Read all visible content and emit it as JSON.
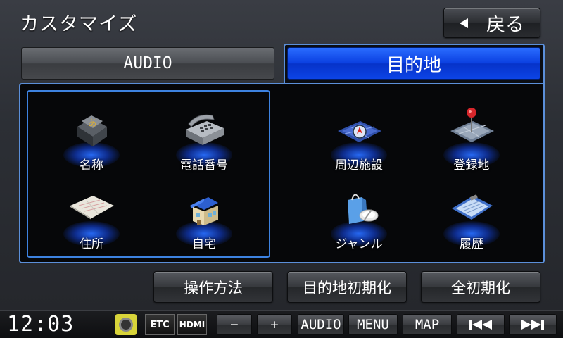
{
  "header": {
    "title": "カスタマイズ",
    "back_label": "戻る"
  },
  "tabs": [
    {
      "label": "AUDIO"
    },
    {
      "label": "目的地"
    }
  ],
  "items": [
    {
      "label": "名称",
      "icon": "name-search-icon"
    },
    {
      "label": "電話番号",
      "icon": "telephone-icon"
    },
    {
      "label": "周辺施設",
      "icon": "nearby-facility-icon"
    },
    {
      "label": "登録地",
      "icon": "registered-location-pin-icon"
    },
    {
      "label": "住所",
      "icon": "address-map-icon"
    },
    {
      "label": "自宅",
      "icon": "home-house-icon"
    },
    {
      "label": "ジャンル",
      "icon": "genre-shopping-icon"
    },
    {
      "label": "履歴",
      "icon": "history-clipboard-icon"
    }
  ],
  "bottom_buttons": {
    "howto": "操作方法",
    "dest_reset": "目的地初期化",
    "all_reset": "全初期化"
  },
  "statusbar": {
    "clock": "12:03",
    "etc": "ETC",
    "hdmi": "HDMI",
    "buttons": {
      "minus": "−",
      "plus": "+",
      "audio": "AUDIO",
      "menu": "MENU",
      "map": "MAP"
    }
  },
  "colors": {
    "accent_blue": "#0a3fe0",
    "frame_blue": "#5b8fd9",
    "glow_blue": "#286eff"
  }
}
